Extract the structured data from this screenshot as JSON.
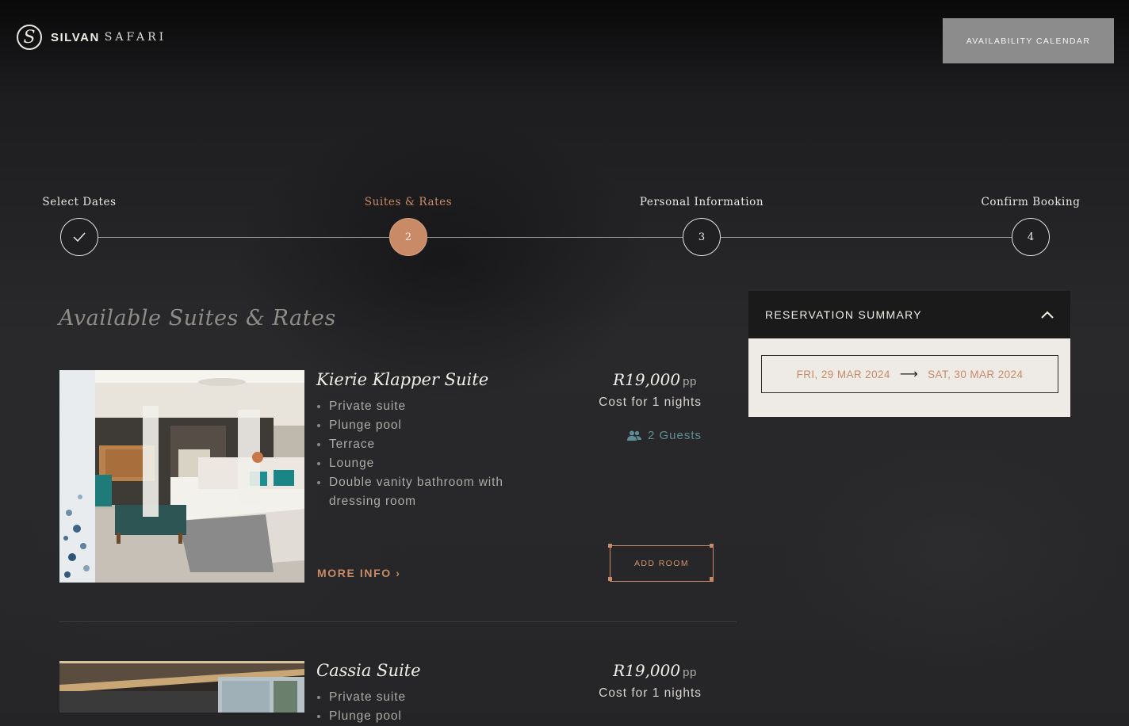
{
  "header": {
    "logo_glyph": "S",
    "logo_word_a": "SILVAN",
    "logo_word_b": "SAFARI",
    "availability_label": "AVAILABILITY CALENDAR"
  },
  "steps": [
    {
      "label": "Select Dates",
      "marker": "✓",
      "state": "done"
    },
    {
      "label": "Suites & Rates",
      "marker": "2",
      "state": "active"
    },
    {
      "label": "Personal Information",
      "marker": "3",
      "state": "pending"
    },
    {
      "label": "Confirm Booking",
      "marker": "4",
      "state": "pending"
    }
  ],
  "section_title": "Available Suites & Rates",
  "suites": [
    {
      "name": "Kierie Klapper Suite",
      "features": [
        "Private suite",
        "Plunge pool",
        "Terrace",
        "Lounge",
        "Double vanity bathroom with dressing room"
      ],
      "price": "R19,000",
      "price_unit": "pp",
      "cost_text": "Cost for 1 nights",
      "guests": "2 Guests",
      "more_info": "MORE INFO ›",
      "add_room": "ADD ROOM"
    },
    {
      "name": "Cassia Suite",
      "features": [
        "Private suite",
        "Plunge pool"
      ],
      "price": "R19,000",
      "price_unit": "pp",
      "cost_text": "Cost for 1 nights"
    }
  ],
  "summary": {
    "title": "RESERVATION SUMMARY",
    "check_in": "FRI, 29 MAR 2024",
    "arrow": "⟶",
    "check_out": "SAT, 30 MAR 2024"
  },
  "colors": {
    "accent": "#c98a67",
    "guests": "#5f8d95",
    "background": "#242426",
    "summary_panel": "#eeebe6"
  },
  "icons": [
    "check-icon",
    "users-icon",
    "chevron-up-icon",
    "arrow-right-icon",
    "chevron-right-icon"
  ]
}
